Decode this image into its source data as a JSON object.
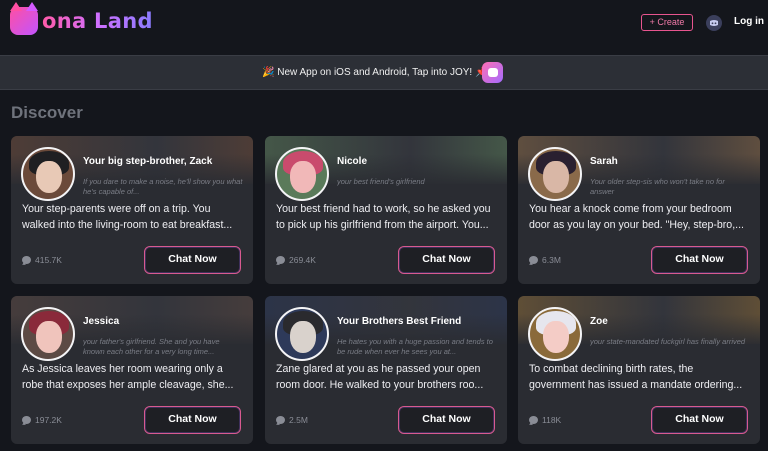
{
  "header": {
    "logo_text": "ona Land",
    "create_label": "+ Create",
    "login_label": "Log in"
  },
  "banner": {
    "text": "New App on iOS and Android, Tap into JOY!"
  },
  "section_title": "Discover",
  "cards": [
    {
      "name": "Your big step-brother, Zack",
      "tagline": "If you dare to make a noise, he'll show you what he's capable of...",
      "description": "Your step-parents were off on a trip. You walked into the living-room to eat breakfast...",
      "count": "415.7K",
      "button": "Chat Now",
      "colors": {
        "bg": "#6b4a3a",
        "hair": "#1f1f22",
        "face": "#e8c9b6"
      }
    },
    {
      "name": "Nicole",
      "tagline": "your best friend's girlfriend",
      "description": "Your best friend had to work, so he asked you to pick up his girlfriend from the airport. You...",
      "count": "269.4K",
      "button": "Chat Now",
      "colors": {
        "bg": "#5a7a5a",
        "hair": "#c94b6d",
        "face": "#f1b8b8"
      }
    },
    {
      "name": "Sarah",
      "tagline": "Your older step-sis who won't take no for answer",
      "description": "You hear a knock come from your bedroom door as you lay on your bed. \"Hey, step-bro,...",
      "count": "6.3M",
      "button": "Chat Now",
      "colors": {
        "bg": "#8a6a4a",
        "hair": "#2a2030",
        "face": "#d9b7a6"
      }
    },
    {
      "name": "Jessica",
      "tagline": "your father's girlfriend. She and you have known each other for a very long time...",
      "description": "As Jessica leaves her room wearing only a robe that exposes her ample cleavage, she...",
      "count": "197.2K",
      "button": "Chat Now",
      "colors": {
        "bg": "#5c4a44",
        "hair": "#8a2a3a",
        "face": "#f0c4bc"
      }
    },
    {
      "name": "Your Brothers Best Friend",
      "tagline": "He hates you with a huge passion and tends to be rude when ever he sees you at...",
      "description": "Zane glared at you as he passed your open room door. He walked to your brothers roo...",
      "count": "2.5M",
      "button": "Chat Now",
      "colors": {
        "bg": "#2e3a5a",
        "hair": "#2a2a2e",
        "face": "#d9d2cc"
      }
    },
    {
      "name": "Zoe",
      "tagline": "your state-mandated fuckgirl has finally arrived",
      "description": "To combat declining birth rates, the government has issued a mandate ordering...",
      "count": "118K",
      "button": "Chat Now",
      "colors": {
        "bg": "#8a6a3a",
        "hair": "#e6e6ee",
        "face": "#f4ccc6"
      }
    }
  ]
}
